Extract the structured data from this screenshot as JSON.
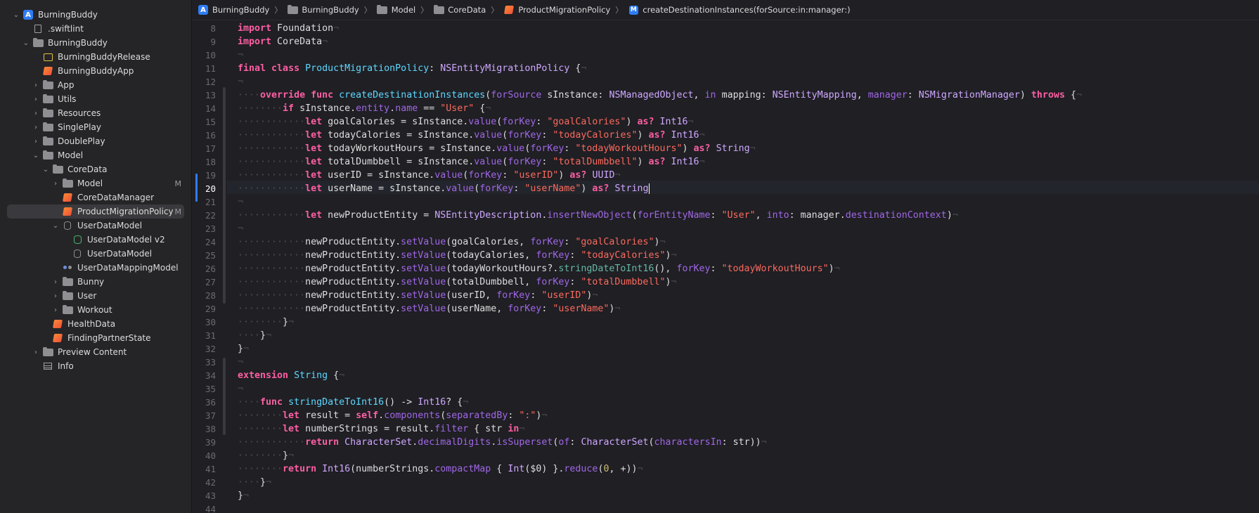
{
  "sidebar": {
    "items": [
      {
        "label": "BurningBuddy",
        "icon": "app-icon",
        "disclosure": "open",
        "indent": 0,
        "badge": ""
      },
      {
        "label": ".swiftlint",
        "icon": "file-icon",
        "disclosure": "",
        "indent": 1,
        "badge": ""
      },
      {
        "label": "BurningBuddy",
        "icon": "folder-icon",
        "disclosure": "open",
        "indent": 1,
        "badge": ""
      },
      {
        "label": "BurningBuddyRelease",
        "icon": "asset-icon",
        "disclosure": "",
        "indent": 2,
        "badge": ""
      },
      {
        "label": "BurningBuddyApp",
        "icon": "swift-icon",
        "disclosure": "",
        "indent": 2,
        "badge": ""
      },
      {
        "label": "App",
        "icon": "folder-icon",
        "disclosure": "closed",
        "indent": 2,
        "badge": ""
      },
      {
        "label": "Utils",
        "icon": "folder-icon",
        "disclosure": "closed",
        "indent": 2,
        "badge": ""
      },
      {
        "label": "Resources",
        "icon": "folder-icon",
        "disclosure": "closed",
        "indent": 2,
        "badge": ""
      },
      {
        "label": "SinglePlay",
        "icon": "folder-icon",
        "disclosure": "closed",
        "indent": 2,
        "badge": ""
      },
      {
        "label": "DoublePlay",
        "icon": "folder-icon",
        "disclosure": "closed",
        "indent": 2,
        "badge": ""
      },
      {
        "label": "Model",
        "icon": "folder-icon",
        "disclosure": "open",
        "indent": 2,
        "badge": ""
      },
      {
        "label": "CoreData",
        "icon": "folder-icon",
        "disclosure": "open",
        "indent": 3,
        "badge": ""
      },
      {
        "label": "Model",
        "icon": "folder-icon",
        "disclosure": "closed",
        "indent": 4,
        "badge": "M"
      },
      {
        "label": "CoreDataManager",
        "icon": "swift-icon",
        "disclosure": "",
        "indent": 4,
        "badge": ""
      },
      {
        "label": "ProductMigrationPolicy",
        "icon": "swift-icon",
        "disclosure": "",
        "indent": 4,
        "badge": "M",
        "selected": true
      },
      {
        "label": "UserDataModel",
        "icon": "db-icon",
        "disclosure": "open",
        "indent": 4,
        "badge": ""
      },
      {
        "label": "UserDataModel v2",
        "icon": "dbgreen-icon",
        "disclosure": "",
        "indent": 5,
        "badge": ""
      },
      {
        "label": "UserDataModel",
        "icon": "db-icon",
        "disclosure": "",
        "indent": 5,
        "badge": ""
      },
      {
        "label": "UserDataMappingModel",
        "icon": "mapping-icon",
        "disclosure": "",
        "indent": 4,
        "badge": ""
      },
      {
        "label": "Bunny",
        "icon": "folder-icon",
        "disclosure": "closed",
        "indent": 4,
        "badge": ""
      },
      {
        "label": "User",
        "icon": "folder-icon",
        "disclosure": "closed",
        "indent": 4,
        "badge": ""
      },
      {
        "label": "Workout",
        "icon": "folder-icon",
        "disclosure": "closed",
        "indent": 4,
        "badge": ""
      },
      {
        "label": "HealthData",
        "icon": "swift-icon",
        "disclosure": "",
        "indent": 3,
        "badge": ""
      },
      {
        "label": "FindingPartnerState",
        "icon": "swift-icon",
        "disclosure": "",
        "indent": 3,
        "badge": ""
      },
      {
        "label": "Preview Content",
        "icon": "folder-icon",
        "disclosure": "closed",
        "indent": 2,
        "badge": ""
      },
      {
        "label": "Info",
        "icon": "table-icon",
        "disclosure": "",
        "indent": 2,
        "badge": ""
      }
    ]
  },
  "jumpbar": {
    "crumbs": [
      {
        "label": "BurningBuddy",
        "icon": "app-icon"
      },
      {
        "label": "BurningBuddy",
        "icon": "folder-icon"
      },
      {
        "label": "Model",
        "icon": "folder-icon"
      },
      {
        "label": "CoreData",
        "icon": "folder-icon"
      },
      {
        "label": "ProductMigrationPolicy",
        "icon": "swift-icon"
      },
      {
        "label": "createDestinationInstances(forSource:in:manager:)",
        "icon": "m-icon"
      }
    ]
  },
  "editor": {
    "current_line": 20,
    "lines": [
      {
        "n": 8,
        "html": "<span class=\"k\">import</span> Foundation<span class=\"x\">¬</span>"
      },
      {
        "n": 9,
        "html": "<span class=\"k\">import</span> CoreData<span class=\"x\">¬</span>"
      },
      {
        "n": 10,
        "html": "<span class=\"x\">¬</span>"
      },
      {
        "n": 11,
        "html": "<span class=\"k\">final</span> <span class=\"k\">class</span> <span class=\"d\">ProductMigrationPolicy</span>: <span class=\"t\">NSEntityMigrationPolicy</span> {<span class=\"x\">¬</span>"
      },
      {
        "n": 12,
        "html": "<span class=\"x\">¬</span>"
      },
      {
        "n": 13,
        "html": "<span class=\"x\">····</span><span class=\"k\">override</span> <span class=\"k\">func</span> <span class=\"d\">createDestinationInstances</span>(<span class=\"p\">forSource</span> sInstance: <span class=\"t\">NSManagedObject</span>, <span class=\"p\">in</span> mapping: <span class=\"t\">NSEntityMapping</span>, <span class=\"p\">manager</span>: <span class=\"t\">NSMigrationManager</span>) <span class=\"k\">throws</span> {<span class=\"x\">¬</span>"
      },
      {
        "n": 14,
        "html": "<span class=\"x\">········</span><span class=\"k\">if</span> sInstance.<span class=\"p\">entity</span>.<span class=\"p\">name</span> == <span class=\"s\">\"User\"</span> {<span class=\"x\">¬</span>"
      },
      {
        "n": 15,
        "html": "<span class=\"x\">············</span><span class=\"k\">let</span> goalCalories = sInstance.<span class=\"p\">value</span>(<span class=\"p\">forKey</span>: <span class=\"s\">\"goalCalories\"</span>) <span class=\"k\">as?</span> <span class=\"t\">Int16</span><span class=\"x\">¬</span>"
      },
      {
        "n": 16,
        "html": "<span class=\"x\">············</span><span class=\"k\">let</span> todayCalories = sInstance.<span class=\"p\">value</span>(<span class=\"p\">forKey</span>: <span class=\"s\">\"todayCalories\"</span>) <span class=\"k\">as?</span> <span class=\"t\">Int16</span><span class=\"x\">¬</span>"
      },
      {
        "n": 17,
        "html": "<span class=\"x\">············</span><span class=\"k\">let</span> todayWorkoutHours = sInstance.<span class=\"p\">value</span>(<span class=\"p\">forKey</span>: <span class=\"s\">\"todayWorkoutHours\"</span>) <span class=\"k\">as?</span> <span class=\"t\">String</span><span class=\"x\">¬</span>"
      },
      {
        "n": 18,
        "html": "<span class=\"x\">············</span><span class=\"k\">let</span> totalDumbbell = sInstance.<span class=\"p\">value</span>(<span class=\"p\">forKey</span>: <span class=\"s\">\"totalDumbbell\"</span>) <span class=\"k\">as?</span> <span class=\"t\">Int16</span><span class=\"x\">¬</span>"
      },
      {
        "n": 19,
        "html": "<span class=\"x\">············</span><span class=\"k\">let</span> userID = sInstance.<span class=\"p\">value</span>(<span class=\"p\">forKey</span>: <span class=\"s\">\"userID\"</span>) <span class=\"k\">as?</span> <span class=\"t\">UUID</span><span class=\"x\">¬</span>"
      },
      {
        "n": 20,
        "html": "<span class=\"x\">············</span><span class=\"k\">let</span> userName = sInstance.<span class=\"p\">value</span>(<span class=\"p\">forKey</span>: <span class=\"s\">\"userName\"</span>) <span class=\"k\">as?</span> <span class=\"t\">String</span><span class=\"caret\"></span>"
      },
      {
        "n": 21,
        "html": "<span class=\"x\">¬</span>"
      },
      {
        "n": 22,
        "html": "<span class=\"x\">············</span><span class=\"k\">let</span> newProductEntity = <span class=\"t\">NSEntityDescription</span>.<span class=\"p\">insertNewObject</span>(<span class=\"p\">forEntityName</span>: <span class=\"s\">\"User\"</span>, <span class=\"p\">into</span>: manager.<span class=\"p\">destinationContext</span>)<span class=\"x\">¬</span>"
      },
      {
        "n": 23,
        "html": "<span class=\"x\">¬</span>"
      },
      {
        "n": 24,
        "html": "<span class=\"x\">············</span>newProductEntity.<span class=\"p\">setValue</span>(goalCalories, <span class=\"p\">forKey</span>: <span class=\"s\">\"goalCalories\"</span>)<span class=\"x\">¬</span>"
      },
      {
        "n": 25,
        "html": "<span class=\"x\">············</span>newProductEntity.<span class=\"p\">setValue</span>(todayCalories, <span class=\"p\">forKey</span>: <span class=\"s\">\"todayCalories\"</span>)<span class=\"x\">¬</span>"
      },
      {
        "n": 26,
        "html": "<span class=\"x\">············</span>newProductEntity.<span class=\"p\">setValue</span>(todayWorkoutHours?.<span class=\"f\">stringDateToInt16</span>(), <span class=\"p\">forKey</span>: <span class=\"s\">\"todayWorkoutHours\"</span>)<span class=\"x\">¬</span>"
      },
      {
        "n": 27,
        "html": "<span class=\"x\">············</span>newProductEntity.<span class=\"p\">setValue</span>(totalDumbbell, <span class=\"p\">forKey</span>: <span class=\"s\">\"totalDumbbell\"</span>)<span class=\"x\">¬</span>"
      },
      {
        "n": 28,
        "html": "<span class=\"x\">············</span>newProductEntity.<span class=\"p\">setValue</span>(userID, <span class=\"p\">forKey</span>: <span class=\"s\">\"userID\"</span>)<span class=\"x\">¬</span>"
      },
      {
        "n": 29,
        "html": "<span class=\"x\">············</span>newProductEntity.<span class=\"p\">setValue</span>(userName, <span class=\"p\">forKey</span>: <span class=\"s\">\"userName\"</span>)<span class=\"x\">¬</span>"
      },
      {
        "n": 30,
        "html": "<span class=\"x\">········</span>}<span class=\"x\">¬</span>"
      },
      {
        "n": 31,
        "html": "<span class=\"x\">····</span>}<span class=\"x\">¬</span>"
      },
      {
        "n": 32,
        "html": "}<span class=\"x\">¬</span>"
      },
      {
        "n": 33,
        "html": "<span class=\"x\">¬</span>"
      },
      {
        "n": 34,
        "html": "<span class=\"k\">extension</span> <span class=\"d\">String</span> {<span class=\"x\">¬</span>"
      },
      {
        "n": 35,
        "html": "<span class=\"x\">¬</span>"
      },
      {
        "n": 36,
        "html": "<span class=\"x\">····</span><span class=\"k\">func</span> <span class=\"d\">stringDateToInt16</span>() -> <span class=\"t\">Int16</span>? {<span class=\"x\">¬</span>"
      },
      {
        "n": 37,
        "html": "<span class=\"x\">········</span><span class=\"k\">let</span> result = <span class=\"k\">self</span>.<span class=\"p\">components</span>(<span class=\"p\">separatedBy</span>: <span class=\"s\">\":\"</span>)<span class=\"x\">¬</span>"
      },
      {
        "n": 38,
        "html": "<span class=\"x\">········</span><span class=\"k\">let</span> numberStrings = result.<span class=\"p\">filter</span> { str <span class=\"k\">in</span><span class=\"x\">¬</span>"
      },
      {
        "n": 39,
        "html": "<span class=\"x\">············</span><span class=\"k\">return</span> <span class=\"t\">CharacterSet</span>.<span class=\"p\">decimalDigits</span>.<span class=\"p\">isSuperset</span>(<span class=\"p\">of</span>: <span class=\"t\">CharacterSet</span>(<span class=\"p\">charactersIn</span>: str))<span class=\"x\">¬</span>"
      },
      {
        "n": 40,
        "html": "<span class=\"x\">········</span>}<span class=\"x\">¬</span>"
      },
      {
        "n": 41,
        "html": "<span class=\"x\">········</span><span class=\"k\">return</span> <span class=\"t\">Int16</span>(numberStrings.<span class=\"p\">compactMap</span> { <span class=\"t\">Int</span>($0) }.<span class=\"p\">reduce</span>(<span class=\"n\">0</span>, +))<span class=\"x\">¬</span>"
      },
      {
        "n": 42,
        "html": "<span class=\"x\">····</span>}<span class=\"x\">¬</span>"
      },
      {
        "n": 43,
        "html": "}<span class=\"x\">¬</span>"
      },
      {
        "n": 44,
        "html": ""
      }
    ]
  }
}
